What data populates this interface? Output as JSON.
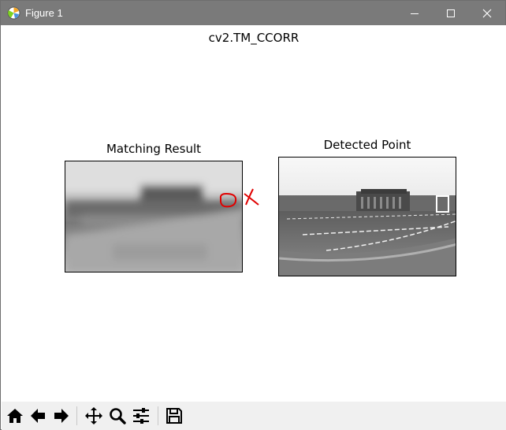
{
  "window": {
    "title": "Figure 1",
    "icons": [
      "matplotlib-icon",
      "minimize-icon",
      "maximize-icon",
      "close-icon"
    ]
  },
  "figure": {
    "suptitle": "cv2.TM_CCORR",
    "subplots": [
      {
        "title": "Matching Result",
        "image": "blurred grayscale correlation map"
      },
      {
        "title": "Detected Point",
        "image": "grayscale photo of building with parking lot, white rectangle marking detection"
      }
    ],
    "annotation": {
      "color": "#e00000",
      "marks": [
        "circle",
        "x"
      ]
    }
  },
  "toolbar": {
    "buttons": [
      "home-icon",
      "back-icon",
      "forward-icon",
      "pan-icon",
      "zoom-icon",
      "configure-subplots-icon",
      "save-icon"
    ]
  },
  "colors": {
    "titlebar": "#7a7a7a",
    "toolbar": "#f0f0f0",
    "annotation": "#e00000"
  }
}
